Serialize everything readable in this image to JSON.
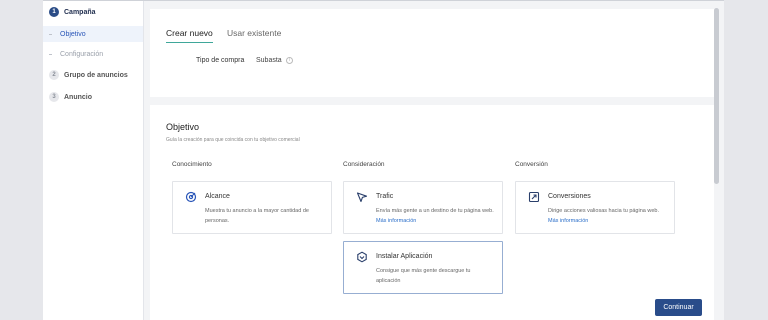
{
  "sidebar": {
    "steps": [
      {
        "num": "1",
        "label": "Campaña"
      },
      {
        "num": "2",
        "label": "Grupo de anuncios"
      },
      {
        "num": "3",
        "label": "Anuncio"
      }
    ],
    "substeps": [
      {
        "label": "Objetivo"
      },
      {
        "label": "Configuración"
      }
    ]
  },
  "tabs": {
    "create": "Crear nuevo",
    "existing": "Usar existente"
  },
  "purchase": {
    "label": "Tipo de compra",
    "value": "Subasta",
    "info": "i"
  },
  "objective": {
    "title": "Objetivo",
    "subtitle": "Guía la creación para que coincida con tu objetivo comercial"
  },
  "categories": [
    "Conocimiento",
    "Consideración",
    "Conversión"
  ],
  "cards": [
    {
      "title": "Alcance",
      "desc": "Muestra tu anuncio a la mayor cantidad de personas.",
      "more": "",
      "icon": "target-icon"
    },
    {
      "title": "Trafic",
      "desc": "Envía más gente a un destino de tu página web.",
      "more": "Más información",
      "icon": "cursor-icon"
    },
    {
      "title": "Conversiones",
      "desc": "Dirige acciones valiosas hacia tu página web.",
      "more": "Más información",
      "icon": "conversion-icon"
    },
    {
      "title": "Instalar Aplicación",
      "desc": "Consigue que más gente descargue tu aplicación",
      "more": "",
      "icon": "app-icon"
    }
  ],
  "continue_label": "Continuar",
  "colors": {
    "primary": "#294c8a",
    "accent_tab": "#3fa79a",
    "link": "#2a6ec9"
  }
}
